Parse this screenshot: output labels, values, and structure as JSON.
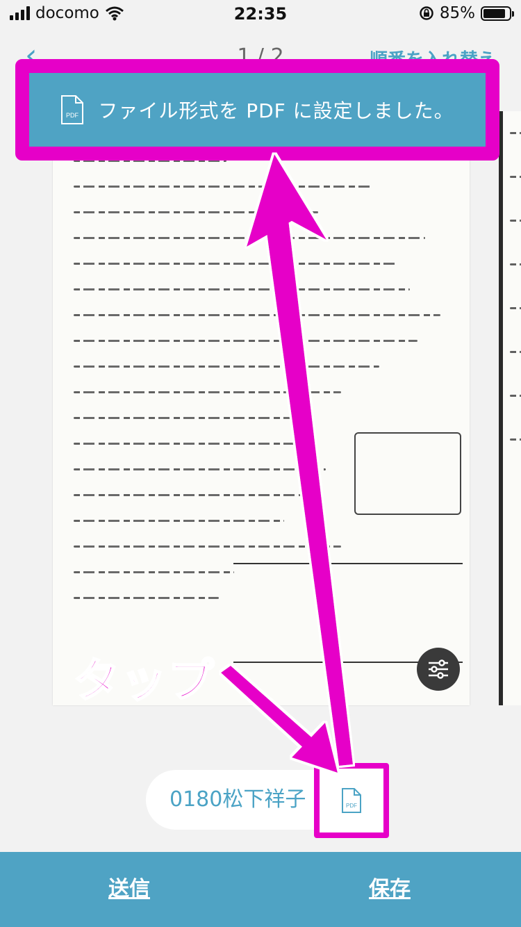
{
  "status_bar": {
    "carrier": "docomo",
    "time": "22:35",
    "battery": "85%",
    "battery_level": 0.85,
    "icons": [
      "signal-icon",
      "wifi-icon",
      "rotation-lock-icon",
      "battery-icon"
    ]
  },
  "nav": {
    "back": "‹",
    "page_indicator": "1 / 2",
    "reorder_label": "順番を入れ替え"
  },
  "toast": {
    "icon": "pdf-file-icon",
    "icon_text": "PDF",
    "message": "ファイル形式を PDF に設定しました。"
  },
  "document": {
    "filter_icon": "sliders-icon"
  },
  "file": {
    "name": "0180松下祥子",
    "format_icon": "pdf-file-icon",
    "format_icon_text": "PDF"
  },
  "bottom_bar": {
    "send_label": "送信",
    "save_label": "保存"
  },
  "annotation": {
    "tap_label": "タップ",
    "color": "#e600c8"
  },
  "colors": {
    "accent": "#4fa3c4",
    "highlight": "#e600c8",
    "background": "#f2f2f2"
  }
}
